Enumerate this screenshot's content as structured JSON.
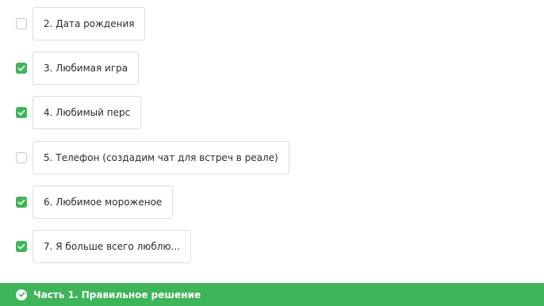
{
  "items": [
    {
      "label": "2. Дата рождения",
      "checked": false
    },
    {
      "label": "3. Любимая игра",
      "checked": true
    },
    {
      "label": "4. Любимый перс",
      "checked": true
    },
    {
      "label": "5. Телефон (создадим чат для встреч в реале)",
      "checked": false
    },
    {
      "label": "6. Любимое мороженое",
      "checked": true
    },
    {
      "label": "7. Я больше всего люблю...",
      "checked": true
    }
  ],
  "banner": {
    "icon": "check-circle-icon",
    "text": "Часть 1. Правильное решение"
  },
  "colors": {
    "accent": "#3db558",
    "border": "#dcdcdc"
  }
}
